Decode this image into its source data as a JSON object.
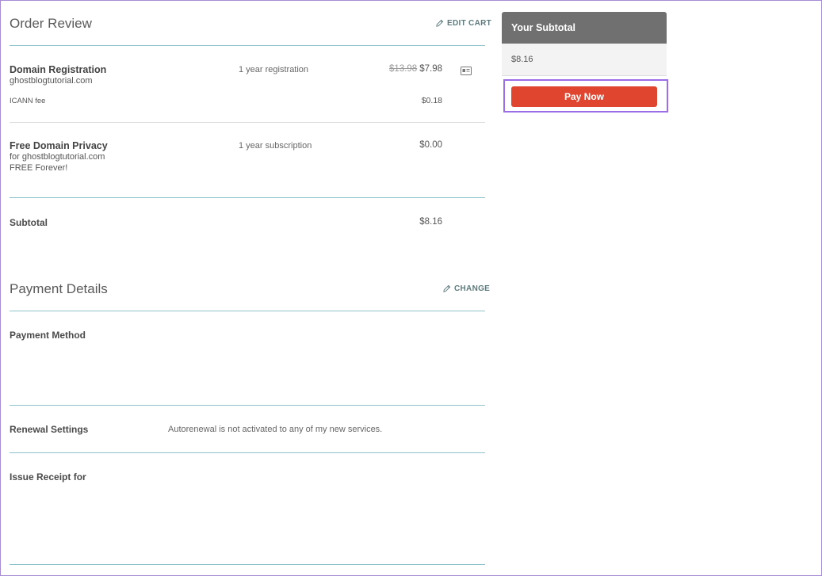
{
  "order": {
    "title": "Order Review",
    "edit_label": "EDIT CART",
    "items": [
      {
        "name": "Domain Registration",
        "domain": "ghostblogtutorial.com",
        "term": "1 year registration",
        "old_price": "$13.98",
        "price": "$7.98",
        "fee_label": "ICANN fee",
        "fee_price": "$0.18"
      },
      {
        "name": "Free Domain Privacy",
        "detail": "for ghostblogtutorial.com",
        "detail2": "FREE Forever!",
        "term": "1 year subscription",
        "price": "$0.00"
      }
    ],
    "subtotal_label": "Subtotal",
    "subtotal_value": "$8.16"
  },
  "payment": {
    "title": "Payment Details",
    "change_label": "CHANGE",
    "method_label": "Payment Method",
    "renewal_label": "Renewal Settings",
    "renewal_text": "Autorenewal is not activated to any of my new services.",
    "receipt_label": "Issue Receipt for"
  },
  "sidebar": {
    "title": "Your Subtotal",
    "amount": "$8.16",
    "pay_label": "Pay Now"
  },
  "colors": {
    "accent_teal": "#8fc3cb",
    "pay_button": "#e0452f",
    "highlight": "#9b6ee8"
  }
}
